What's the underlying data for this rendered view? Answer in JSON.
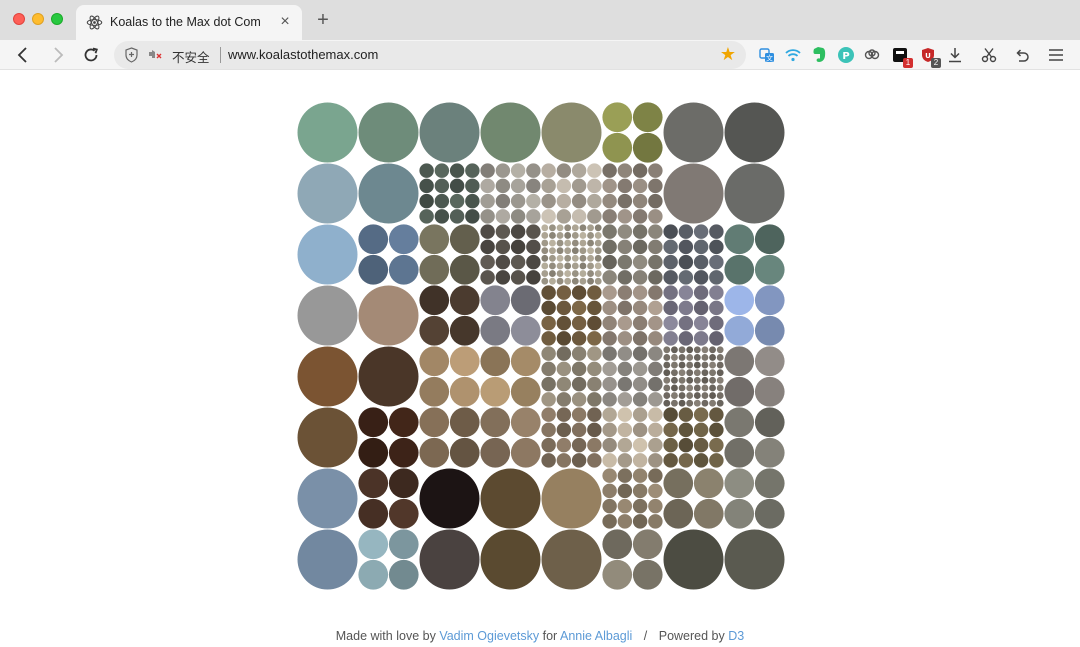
{
  "tab": {
    "title": "Koalas to the Max dot Com",
    "close_glyph": "×",
    "icon": "react-like-atom-icon"
  },
  "new_tab_glyph": "+",
  "address_bar": {
    "security_label": "不安全",
    "url": "www.koalastothemax.com",
    "bookmark_glyph": "★"
  },
  "extensions": [
    {
      "name": "translate-ext-icon",
      "color": "#2f8fe0"
    },
    {
      "name": "wifi-ext-icon",
      "color": "#2fa8e0"
    },
    {
      "name": "evernote-ext-icon",
      "color": "#2dbe60"
    },
    {
      "name": "p-ext-icon",
      "color": "#3cc3b8"
    },
    {
      "name": "cloud-ext-icon",
      "color": "#555555"
    },
    {
      "name": "counter-ext-icon",
      "color": "#111111",
      "badge": "1"
    },
    {
      "name": "shield-ext-icon",
      "color": "#c62828",
      "badge": "2"
    },
    {
      "name": "download-icon",
      "color": "#444444"
    },
    {
      "name": "scissors-icon",
      "color": "#444444"
    },
    {
      "name": "undo-icon",
      "color": "#444444"
    },
    {
      "name": "menu-icon",
      "color": "#444444"
    }
  ],
  "mosaic": {
    "grid": 8,
    "palette": {
      "r0": [
        "#7aa58f",
        "#6e8c7a",
        "#6b817c",
        "#71886f",
        "#8a8a6c",
        "#8c914e",
        "#6c6c68",
        "#555653"
      ],
      "r1": [
        "#8fa8b6",
        "#6d8890",
        "#4e5a52",
        "#9e9a92",
        "#b3ab9f",
        "#8c8278",
        "#807974",
        "#6a6b68"
      ],
      "r2": [
        "#8fb0cc",
        "#5f7794",
        "#6e6a56",
        "#55504a",
        "#a39c8c",
        "#7e7a70",
        "#5b6068",
        "#5f7a72"
      ],
      "r3": [
        "#989898",
        "#a48a76",
        "#4a3a2e",
        "#7c7c86",
        "#6e5a3e",
        "#9a8c80",
        "#7b7889",
        "#8aa0cc"
      ],
      "r4": [
        "#7b5432",
        "#4a3628",
        "#a58a68",
        "#a88e6a",
        "#8c8474",
        "#8e8a84",
        "#767068",
        "#8a8480"
      ],
      "r5": [
        "#6b5236",
        "#3e2418",
        "#7a6650",
        "#8a7660",
        "#7e6e5c",
        "#b6aa98",
        "#6a5e44",
        "#78766e"
      ],
      "r6": [
        "#7a90a8",
        "#4a3226",
        "#1c1414",
        "#5c4a30",
        "#968060",
        "#8a7c68",
        "#7e7664",
        "#7c7c72"
      ],
      "r7": [
        "#7288a0",
        "#84a0a8",
        "#4a4240",
        "#5a4a30",
        "#6e604a",
        "#807a6c",
        "#4c4c42",
        "#5a5a50"
      ]
    }
  },
  "footer": {
    "made_with": "Made with love by",
    "author1": "Vadim Ogievetsky",
    "for": "for",
    "author2": "Annie Albagli",
    "slash": "/",
    "powered": "Powered by",
    "d3": "D3"
  }
}
